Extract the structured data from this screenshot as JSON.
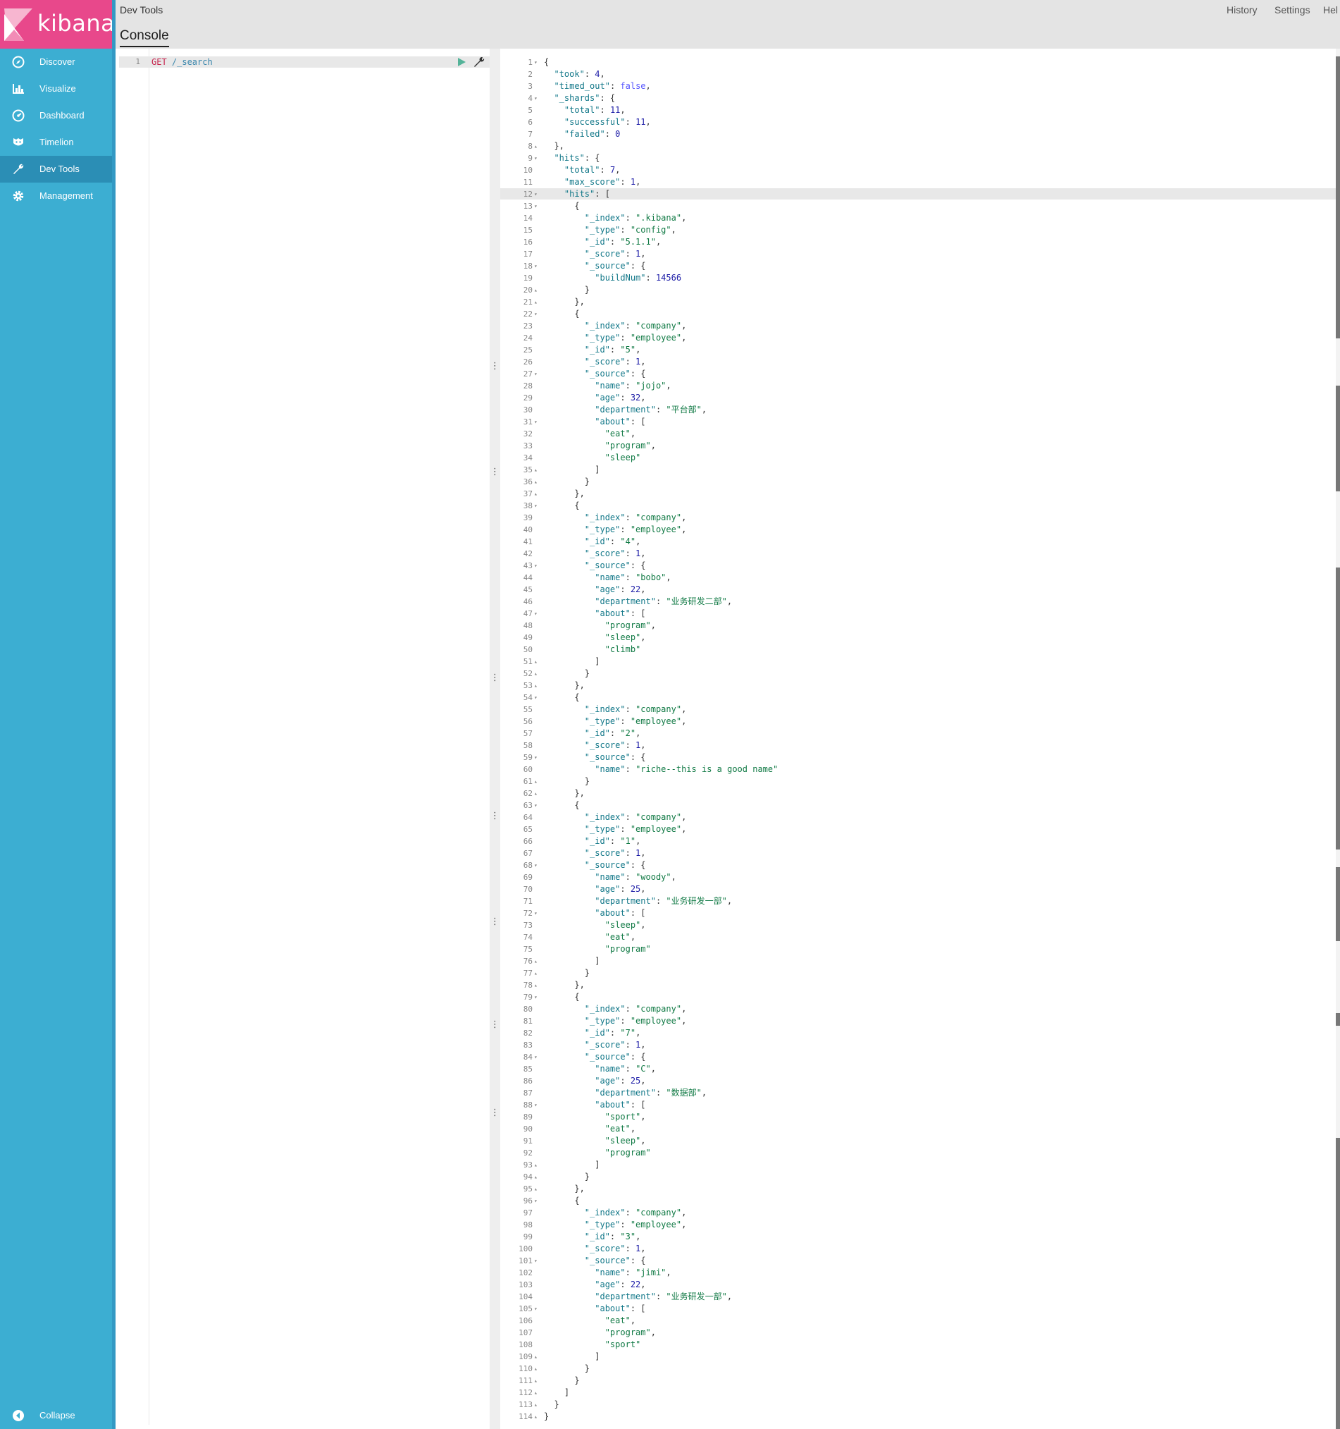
{
  "brand": {
    "name": "kibana",
    "accent": "#e8488b",
    "nav_bg": "#3caed2",
    "nav_active_bg": "#2b8eb5"
  },
  "sidebar": {
    "items": [
      {
        "label": "Discover",
        "icon": "compass-icon"
      },
      {
        "label": "Visualize",
        "icon": "bar-chart-icon"
      },
      {
        "label": "Dashboard",
        "icon": "dashboard-icon"
      },
      {
        "label": "Timelion",
        "icon": "timelion-icon"
      },
      {
        "label": "Dev Tools",
        "icon": "wrench-icon",
        "active": true
      },
      {
        "label": "Management",
        "icon": "gear-icon"
      }
    ],
    "collapse_label": "Collapse"
  },
  "header": {
    "app_title": "Dev Tools",
    "tab": "Console",
    "links": [
      "History",
      "Settings",
      "Hel"
    ]
  },
  "editor": {
    "line_number": "1",
    "method": "GET",
    "url": " /_search"
  },
  "output": {
    "line_count": 114,
    "active_line": 12,
    "lines": [
      "{",
      "  \"took\": 4,",
      "  \"timed_out\": false,",
      "  \"_shards\": {",
      "    \"total\": 11,",
      "    \"successful\": 11,",
      "    \"failed\": 0",
      "  },",
      "  \"hits\": {",
      "    \"total\": 7,",
      "    \"max_score\": 1,",
      "    \"hits\": [",
      "      {",
      "        \"_index\": \".kibana\",",
      "        \"_type\": \"config\",",
      "        \"_id\": \"5.1.1\",",
      "        \"_score\": 1,",
      "        \"_source\": {",
      "          \"buildNum\": 14566",
      "        }",
      "      },",
      "      {",
      "        \"_index\": \"company\",",
      "        \"_type\": \"employee\",",
      "        \"_id\": \"5\",",
      "        \"_score\": 1,",
      "        \"_source\": {",
      "          \"name\": \"jojo\",",
      "          \"age\": 32,",
      "          \"department\": \"平台部\",",
      "          \"about\": [",
      "            \"eat\",",
      "            \"program\",",
      "            \"sleep\"",
      "          ]",
      "        }",
      "      },",
      "      {",
      "        \"_index\": \"company\",",
      "        \"_type\": \"employee\",",
      "        \"_id\": \"4\",",
      "        \"_score\": 1,",
      "        \"_source\": {",
      "          \"name\": \"bobo\",",
      "          \"age\": 22,",
      "          \"department\": \"业务研发二部\",",
      "          \"about\": [",
      "            \"program\",",
      "            \"sleep\",",
      "            \"climb\"",
      "          ]",
      "        }",
      "      },",
      "      {",
      "        \"_index\": \"company\",",
      "        \"_type\": \"employee\",",
      "        \"_id\": \"2\",",
      "        \"_score\": 1,",
      "        \"_source\": {",
      "          \"name\": \"riche--this is a good name\"",
      "        }",
      "      },",
      "      {",
      "        \"_index\": \"company\",",
      "        \"_type\": \"employee\",",
      "        \"_id\": \"1\",",
      "        \"_score\": 1,",
      "        \"_source\": {",
      "          \"name\": \"woody\",",
      "          \"age\": 25,",
      "          \"department\": \"业务研发一部\",",
      "          \"about\": [",
      "            \"sleep\",",
      "            \"eat\",",
      "            \"program\"",
      "          ]",
      "        }",
      "      },",
      "      {",
      "        \"_index\": \"company\",",
      "        \"_type\": \"employee\",",
      "        \"_id\": \"7\",",
      "        \"_score\": 1,",
      "        \"_source\": {",
      "          \"name\": \"C\",",
      "          \"age\": 25,",
      "          \"department\": \"数据部\",",
      "          \"about\": [",
      "            \"sport\",",
      "            \"eat\",",
      "            \"sleep\",",
      "            \"program\"",
      "          ]",
      "        }",
      "      },",
      "      {",
      "        \"_index\": \"company\",",
      "        \"_type\": \"employee\",",
      "        \"_id\": \"3\",",
      "        \"_score\": 1,",
      "        \"_source\": {",
      "          \"name\": \"jimi\",",
      "          \"age\": 22,",
      "          \"department\": \"业务研发一部\",",
      "          \"about\": [",
      "            \"eat\",",
      "            \"program\",",
      "            \"sport\"",
      "          ]",
      "        }",
      "      }",
      "    ]",
      "  }",
      "}"
    ]
  }
}
